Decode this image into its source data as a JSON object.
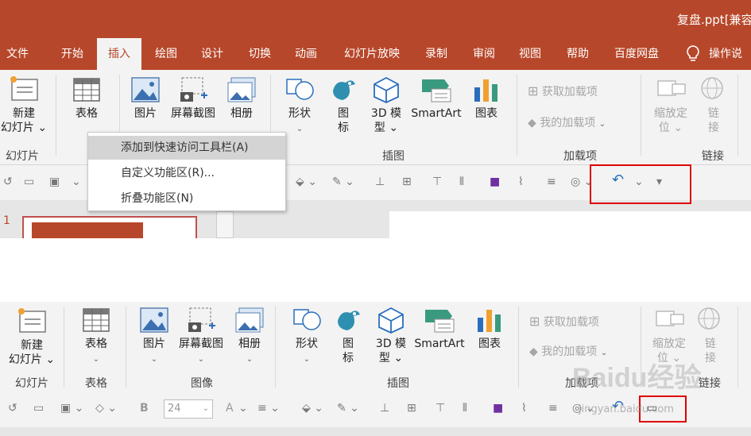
{
  "title_bar": {
    "doc_title": "复盘.ppt[兼容"
  },
  "tabs": [
    "文件",
    "开始",
    "插入",
    "绘图",
    "设计",
    "切换",
    "动画",
    "幻灯片放映",
    "录制",
    "审阅",
    "视图",
    "帮助",
    "百度网盘",
    "操作说"
  ],
  "active_tab": "插入",
  "ribbon": {
    "slides": {
      "btn_line1": "新建",
      "btn_line2": "幻灯片 ⌄",
      "label": "幻灯片"
    },
    "table": {
      "btn": "表格",
      "btn_chev": "⌄",
      "label": "表格"
    },
    "images": {
      "picture": "图片",
      "screenshot": "屏幕截图",
      "album": "相册",
      "label": "图像"
    },
    "illustrations": {
      "shapes": "形状",
      "icons_line1": "图",
      "icons_line2": "标",
      "model_line1": "3D 模",
      "model_line2": "型 ⌄",
      "smartart": "SmartArt",
      "chart": "图表",
      "label": "插图"
    },
    "addins": {
      "get": "获取加载项",
      "mine": "我的加载项",
      "mine_chev": "⌄",
      "label": "加载项"
    },
    "links": {
      "zoom_line1": "缩放定",
      "zoom_line2": "位 ⌄",
      "link_line1": "链",
      "link_line2": "接",
      "label": "链接"
    }
  },
  "context_menu": {
    "items": [
      "添加到快速访问工具栏(A)",
      "自定义功能区(R)...",
      "折叠功能区(N)"
    ]
  },
  "qat": {
    "font_bold": "B",
    "font_size": "24",
    "font_a": "A",
    "undo_chev": "⌄"
  },
  "slide_pane": {
    "slide_number": "1"
  },
  "watermark": {
    "logo": "Baidu经验",
    "url": "jingyan.baidu.com"
  },
  "colors": {
    "accent": "#b7472a",
    "highlight": "#e00000",
    "ribbon_bg": "#f3f3f3"
  }
}
